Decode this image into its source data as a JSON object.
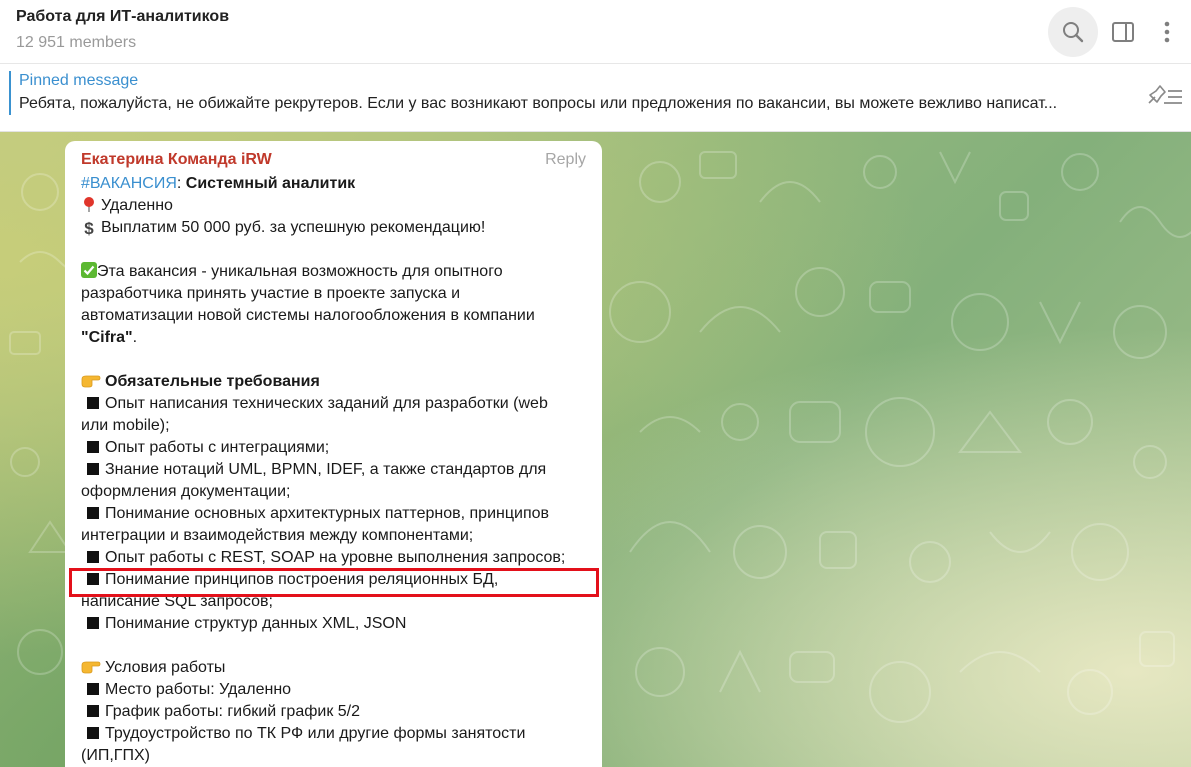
{
  "header": {
    "title": "Работа для ИТ-аналитиков",
    "members": "12 951 members",
    "icons": [
      "search-icon",
      "sidebar-toggle-icon",
      "more-vertical-icon"
    ]
  },
  "pinned": {
    "title": "Pinned message",
    "text": "Ребята, пожалуйста, не обижайте рекрутеров.   Если у вас возникают вопросы или предложения по вакансии, вы можете вежливо написат...",
    "icon": "unpin-list-icon"
  },
  "message": {
    "sender": "Екатерина Команда iRW",
    "reply": "Reply",
    "hashtag": "#ВАКАНСИЯ",
    "title_sep": ": ",
    "title": "Системный аналитик",
    "location": "Удаленно",
    "reward": "Выплатим 50 000 руб. за успешную рекомендацию!",
    "intro_l1": "Эта вакансия -  уникальная возможность для опытного",
    "intro_l2": "разработчика принять участие в проекте запуска и",
    "intro_l3": "автоматизации новой системы налогообложения в компании",
    "company": "\"Cifra\"",
    "company_end": ".",
    "req_title": "Обязательные требования",
    "req1_l1": "Опыт написания технических заданий для разработки (web",
    "req1_l2": "или mobile);",
    "req2": "Опыт работы с интеграциями;",
    "req3_l1": "Знание нотаций UML, BPMN, IDEF, а также стандартов для",
    "req3_l2": "оформления документации;",
    "req4_l1": "Понимание основных архитектурных паттернов, принципов",
    "req4_l2": "интеграции и взаимодействия между компонентами;",
    "req5": "Опыт работы с REST, SOAP на уровне выполнения запросов;",
    "req6_l1": "Понимание принципов построения реляционных БД,",
    "req6_l2": "написание SQL запросов;",
    "req7": "Понимание структур данных XML, JSON",
    "cond_title": "Условия работы",
    "cond1": "Место работы: Удаленно",
    "cond2": "График работы: гибкий график 5/2",
    "cond3_l1": "Трудоустройство по ТК РФ или другие формы занятости",
    "cond3_l2": "(ИП,ГПХ)"
  },
  "colors": {
    "accent": "#3a8fcf",
    "sender": "#c0392b",
    "highlight_box": "#e3101a"
  }
}
